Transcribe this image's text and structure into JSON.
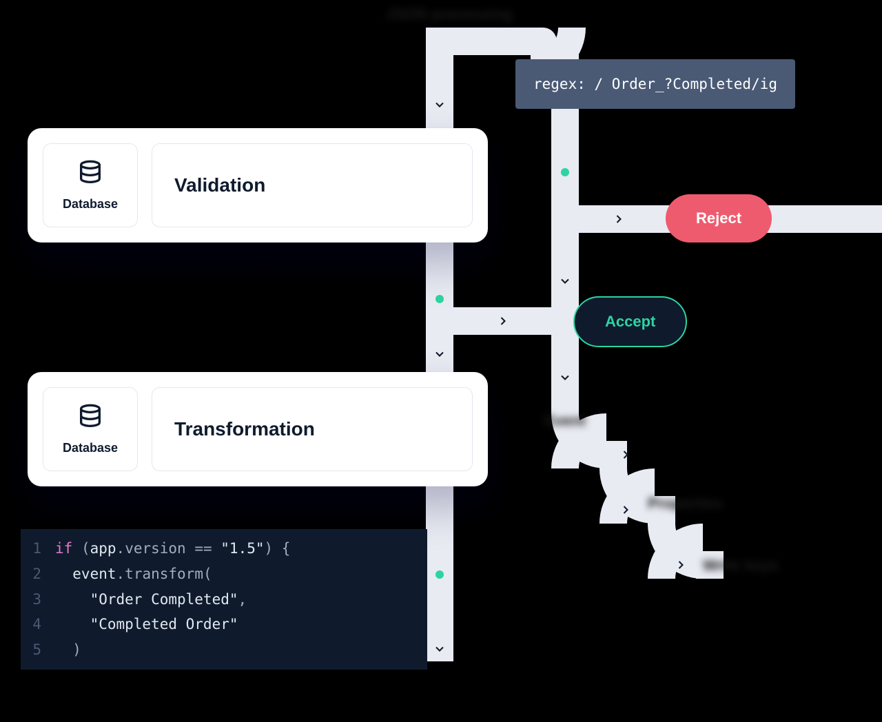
{
  "header_blur": "JSON processing",
  "cards": {
    "validation": {
      "icon_label": "Database",
      "title": "Validation"
    },
    "transformation": {
      "icon_label": "Database",
      "title": "Transformation"
    }
  },
  "regex_box": "regex: / Order_?Completed/ig",
  "pills": {
    "reject": "Reject",
    "accept": "Accept"
  },
  "flow_labels": {
    "event": "Event",
    "properties": "Properties",
    "writekeys": "Write keys"
  },
  "code": {
    "lines": [
      {
        "n": "1",
        "tokens": [
          {
            "t": "if",
            "c": "tok-kw"
          },
          {
            "t": " (",
            "c": "tok-punc"
          },
          {
            "t": "app",
            "c": "tok-id"
          },
          {
            "t": ".",
            "c": "tok-punc"
          },
          {
            "t": "version",
            "c": "tok-prop"
          },
          {
            "t": " == ",
            "c": "tok-punc"
          },
          {
            "t": "\"1.5\"",
            "c": "tok-str"
          },
          {
            "t": ") {",
            "c": "tok-punc"
          }
        ]
      },
      {
        "n": "2",
        "tokens": [
          {
            "t": "  event",
            "c": "tok-id"
          },
          {
            "t": ".",
            "c": "tok-punc"
          },
          {
            "t": "transform",
            "c": "tok-prop"
          },
          {
            "t": "(",
            "c": "tok-punc"
          }
        ]
      },
      {
        "n": "3",
        "tokens": [
          {
            "t": "    \"Order Completed\"",
            "c": "tok-str"
          },
          {
            "t": ",",
            "c": "tok-punc"
          }
        ]
      },
      {
        "n": "4",
        "tokens": [
          {
            "t": "    \"Completed Order\"",
            "c": "tok-str"
          }
        ]
      },
      {
        "n": "5",
        "tokens": [
          {
            "t": "  )",
            "c": "tok-punc"
          }
        ]
      }
    ]
  }
}
